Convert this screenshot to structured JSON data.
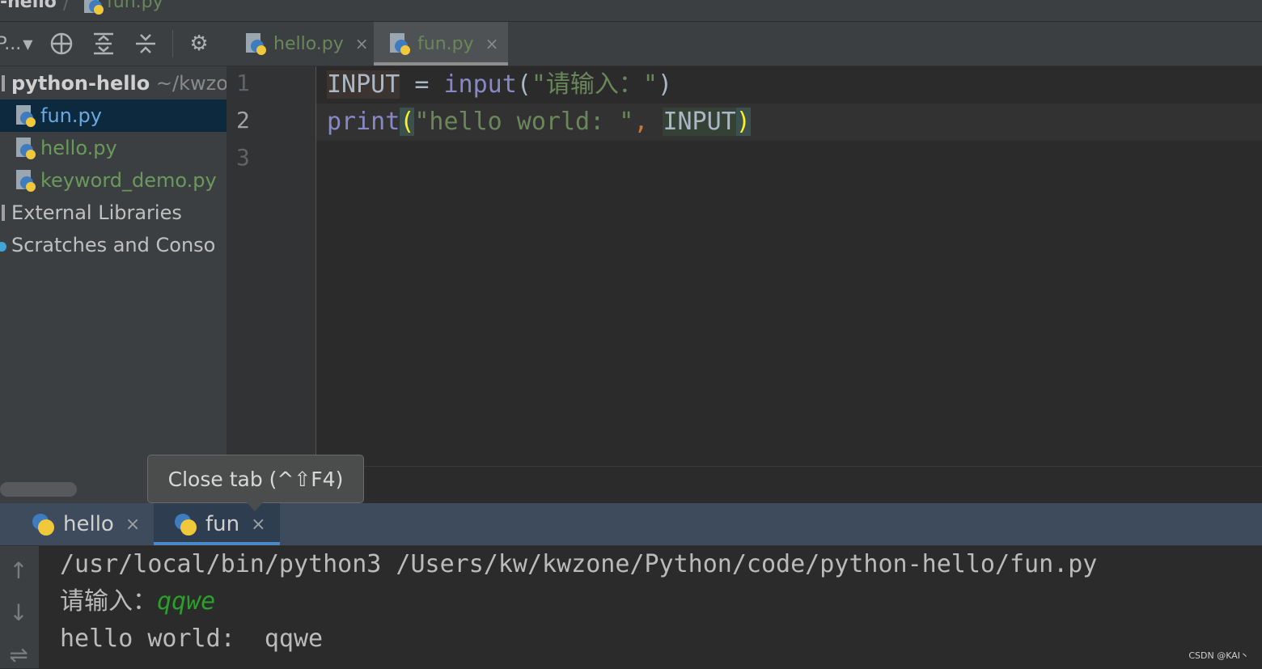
{
  "nav": {
    "project": "-hello",
    "separator": "/",
    "file": "fun.py"
  },
  "project_toolbar": {
    "dropdown_label": "P...",
    "icons": [
      "locate-icon",
      "expand-all-icon",
      "collapse-all-icon",
      "gear-icon"
    ]
  },
  "tree": {
    "root_name": "python-hello",
    "root_path": "~/kwzo",
    "files": [
      "fun.py",
      "hello.py",
      "keyword_demo.py"
    ],
    "external_libraries": "External Libraries",
    "scratches": "Scratches and Conso"
  },
  "editor_tabs": [
    {
      "label": "hello.py",
      "close": "×",
      "active": false
    },
    {
      "label": "fun.py",
      "close": "×",
      "active": true
    }
  ],
  "gutter": {
    "lines": [
      "1",
      "2",
      "3"
    ]
  },
  "code": {
    "line1": {
      "var": "INPUT",
      "op": " = ",
      "fn": "input",
      "open": "(",
      "str": "\"请输入：\"",
      "close": ")"
    },
    "line2": {
      "fn": "print",
      "open": "(",
      "str": "\"hello world: \"",
      "comma": ",",
      "space": " ",
      "var": "INPUT",
      "close": ")"
    }
  },
  "tooltip": {
    "text": "Close tab (^⇧F4)"
  },
  "run_tabs": [
    {
      "label": "hello",
      "close": "×",
      "active": false
    },
    {
      "label": "fun",
      "close": "×",
      "active": true
    }
  ],
  "run_side_icons": [
    "arrow-up-icon",
    "arrow-down-icon",
    "soft-wrap-icon"
  ],
  "console": {
    "command": "/usr/local/bin/python3 /Users/kw/kwzone/Python/code/python-hello/fun.py",
    "prompt": "请输入：",
    "user_input": "qqwe",
    "output": "hello world:  qqwe"
  },
  "watermark": "CSDN @KAI丶",
  "colors": {
    "string": "#6a8759",
    "function": "#8888c6",
    "keyword_var": "#a9b7c6",
    "input_text": "#2aa02a",
    "selected_row": "#0d293e"
  }
}
